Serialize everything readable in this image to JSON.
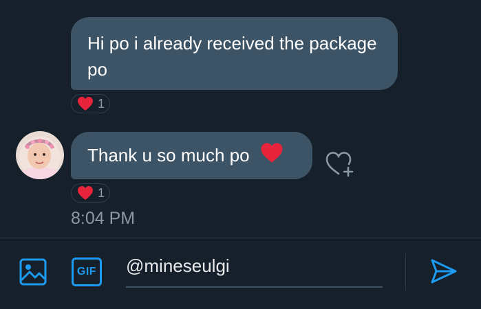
{
  "messages": [
    {
      "text": "Hi po i already received the package po",
      "reaction": {
        "emoji": "red-heart-icon",
        "count": "1"
      }
    },
    {
      "text": "Thank u so much po",
      "inline_emoji": "red-heart-icon",
      "reaction": {
        "emoji": "red-heart-icon",
        "count": "1"
      }
    }
  ],
  "timestamp": "8:04 PM",
  "composer": {
    "gif_label": "GIF",
    "input_value": "@mineseulgi"
  },
  "colors": {
    "background": "#15202b",
    "bubble": "#3d5466",
    "accent": "#1d9bf0",
    "heart": "#f91880",
    "muted_text": "#8b98a5"
  }
}
